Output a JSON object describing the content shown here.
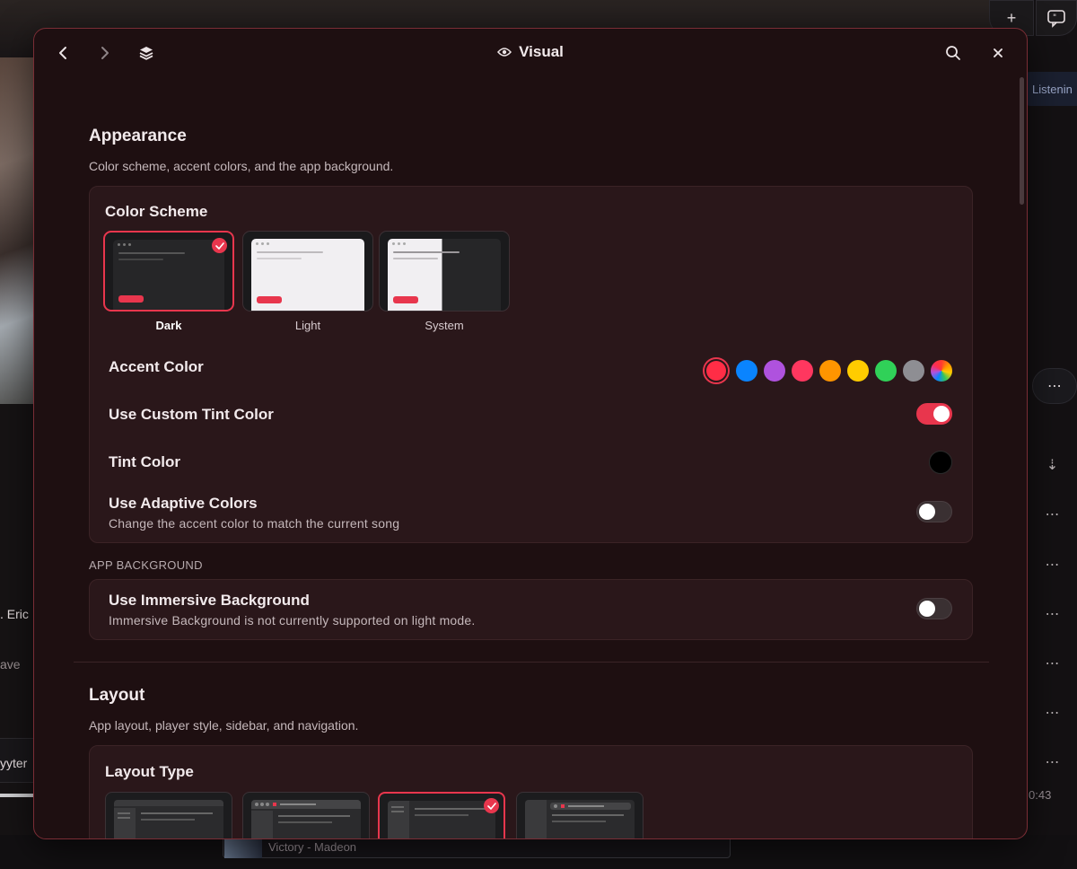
{
  "background_app": {
    "frag_eric": ". Eric",
    "frag_ave": "ave",
    "frag_yyter": "yyter",
    "listening_label": "Listenin",
    "now_playing": "Victory - Madeon",
    "time_label": "0:43"
  },
  "modal": {
    "title": "Visual",
    "appearance": {
      "title": "Appearance",
      "subtitle": "Color scheme, accent colors, and the app background.",
      "color_scheme": {
        "title": "Color Scheme",
        "options": [
          "Dark",
          "Light",
          "System"
        ],
        "selected": "Dark"
      },
      "accent_color": {
        "label": "Accent Color",
        "colors": [
          "#ff2d46",
          "#0a84ff",
          "#af52de",
          "#ff375f",
          "#ff9500",
          "#ffcc00",
          "#30d158",
          "#8e8e93",
          "multicolor"
        ],
        "selected_index": 0
      },
      "custom_tint": {
        "label": "Use Custom Tint Color",
        "enabled": true
      },
      "tint_color": {
        "label": "Tint Color",
        "value": "#000000"
      },
      "adaptive_colors": {
        "label": "Use Adaptive Colors",
        "description": "Change the accent color to match the current song",
        "enabled": false
      }
    },
    "app_background": {
      "header": "APP BACKGROUND",
      "immersive": {
        "label": "Use Immersive Background",
        "description": "Immersive Background is not currently supported on light mode.",
        "enabled": false
      }
    },
    "layout": {
      "title": "Layout",
      "subtitle": "App layout, player style, sidebar, and navigation.",
      "layout_type": {
        "title": "Layout Type",
        "selected_index": 2
      }
    }
  },
  "colors": {
    "accent": "#e8364d",
    "modal_bg": "#1e0f11",
    "card_bg": "#2a171a"
  }
}
